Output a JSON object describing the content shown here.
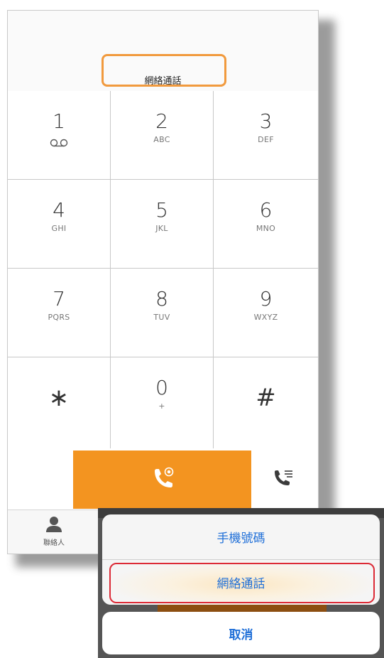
{
  "dialer": {
    "mode_label": "網絡通話",
    "keys": [
      {
        "digit": "1",
        "sub": ""
      },
      {
        "digit": "2",
        "sub": "ABC"
      },
      {
        "digit": "3",
        "sub": "DEF"
      },
      {
        "digit": "4",
        "sub": "GHI"
      },
      {
        "digit": "5",
        "sub": "JKL"
      },
      {
        "digit": "6",
        "sub": "MNO"
      },
      {
        "digit": "7",
        "sub": "PQRS"
      },
      {
        "digit": "8",
        "sub": "TUV"
      },
      {
        "digit": "9",
        "sub": "WXYZ"
      },
      {
        "digit": "∗",
        "sub": ""
      },
      {
        "digit": "0",
        "sub": "+"
      },
      {
        "digit": "#",
        "sub": ""
      }
    ],
    "voicemail_icon": "voicemail-icon",
    "call_icon": "phone-call-icon",
    "call_log_icon": "call-log-icon"
  },
  "tabs": {
    "contacts_label": "聯絡人",
    "contacts_icon": "person-icon"
  },
  "action_sheet": {
    "option_mobile": "手機號碼",
    "option_network": "網絡通話",
    "cancel": "取消"
  },
  "colors": {
    "accent_orange": "#f39420",
    "highlight_orange": "#f19a3e",
    "highlight_red": "#dc2a36",
    "action_blue": "#1f6fd8"
  }
}
